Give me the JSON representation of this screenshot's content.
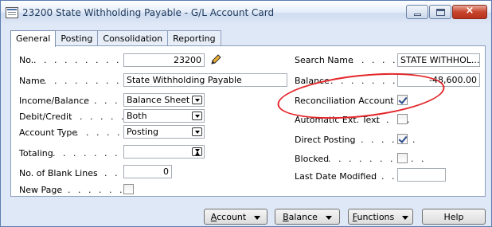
{
  "window": {
    "title": "23200 State Withholding Payable - G/L Account Card",
    "close_label": "×"
  },
  "tabs": [
    "General",
    "Posting",
    "Consolidation",
    "Reporting"
  ],
  "left_fields": {
    "no": {
      "label": "No.",
      "dots": ". . . . . . . . . . .",
      "value": "23200"
    },
    "name": {
      "label": "Name",
      "dots": ". . . . . . . . . .",
      "value": "State Withholding Payable"
    },
    "income_balance": {
      "label": "Income/Balance",
      "dots": ". . . . .",
      "value": "Balance Sheet"
    },
    "debit_credit": {
      "label": "Debit/Credit",
      "dots": ". . . . . . .",
      "value": "Both"
    },
    "account_type": {
      "label": "Account Type",
      "dots": ". . . . . .",
      "value": "Posting"
    },
    "totaling": {
      "label": "Totaling",
      "dots": ". . . . . . . .",
      "value": ""
    },
    "blank_lines": {
      "label": "No. of Blank Lines",
      "dots": ". . .",
      "value": "0"
    },
    "new_page": {
      "label": "New Page",
      "dots": ". . . . . . . .",
      "checked": false
    }
  },
  "right_fields": {
    "search_name": {
      "label": "Search Name",
      "dots": ". . . . . .",
      "value": "STATE WITHHOL..."
    },
    "balance": {
      "label": "Balance",
      "dots": ". . . . . . . . . .",
      "value": "-48,600.00"
    },
    "reconciliation": {
      "label": "Reconciliation Account",
      "dots": ". .",
      "checked": true
    },
    "automatic_ext": {
      "label": "Automatic Ext. Text",
      "dots": ". . . .",
      "checked": false
    },
    "direct_posting": {
      "label": "Direct Posting",
      "dots": ". . . . . . .",
      "checked": true
    },
    "blocked": {
      "label": "Blocked",
      "dots": ". . . . . . . . . .",
      "checked": false
    },
    "last_modified": {
      "label": "Last Date Modified",
      "dots": ". . .",
      "value": ""
    }
  },
  "buttons": {
    "account": {
      "first": "A",
      "rest": "ccount"
    },
    "balance": {
      "first": "B",
      "rest": "alance"
    },
    "functions": {
      "first": "F",
      "rest": "unctions"
    },
    "help": "Help"
  },
  "colors": {
    "highlight_oval": "#e3262a",
    "window_bg": "#dfe8f6"
  },
  "icons": [
    "app-icon",
    "pencil-icon",
    "dropdown-arrow-icon",
    "lookup-arrow-icon",
    "checkbox-icon"
  ]
}
